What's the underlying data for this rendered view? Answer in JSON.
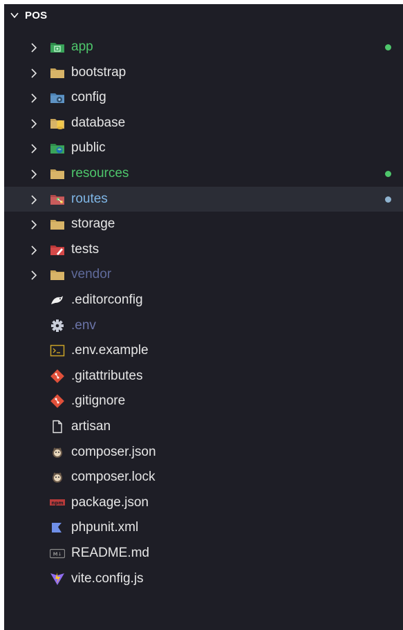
{
  "explorer": {
    "root_title": "POS",
    "items": [
      {
        "label": "app",
        "type": "folder",
        "icon": "app-folder-icon",
        "label_color": "#4ec66b",
        "status_dot": "#4ec66b"
      },
      {
        "label": "bootstrap",
        "type": "folder",
        "icon": "folder-icon"
      },
      {
        "label": "config",
        "type": "folder",
        "icon": "config-folder-icon"
      },
      {
        "label": "database",
        "type": "folder",
        "icon": "database-folder-icon"
      },
      {
        "label": "public",
        "type": "folder",
        "icon": "public-folder-icon"
      },
      {
        "label": "resources",
        "type": "folder",
        "icon": "folder-icon",
        "label_color": "#4ec66b",
        "status_dot": "#4ec66b"
      },
      {
        "label": "routes",
        "type": "folder",
        "icon": "routes-folder-icon",
        "label_color": "#7fb6e6",
        "status_dot": "#8fb3cf",
        "selected": true
      },
      {
        "label": "storage",
        "type": "folder",
        "icon": "folder-icon"
      },
      {
        "label": "tests",
        "type": "folder",
        "icon": "tests-folder-icon"
      },
      {
        "label": "vendor",
        "type": "folder",
        "icon": "folder-icon",
        "label_color": "#5f6a9a"
      },
      {
        "label": ".editorconfig",
        "type": "file",
        "icon": "editorconfig-icon"
      },
      {
        "label": ".env",
        "type": "file",
        "icon": "gear-icon",
        "label_color": "#6b74a8"
      },
      {
        "label": ".env.example",
        "type": "file",
        "icon": "terminal-icon"
      },
      {
        "label": ".gitattributes",
        "type": "file",
        "icon": "git-icon"
      },
      {
        "label": ".gitignore",
        "type": "file",
        "icon": "git-icon"
      },
      {
        "label": "artisan",
        "type": "file",
        "icon": "file-icon"
      },
      {
        "label": "composer.json",
        "type": "file",
        "icon": "composer-icon"
      },
      {
        "label": "composer.lock",
        "type": "file",
        "icon": "composer-icon"
      },
      {
        "label": "package.json",
        "type": "file",
        "icon": "npm-icon",
        "icon_text": "npm"
      },
      {
        "label": "phpunit.xml",
        "type": "file",
        "icon": "phpunit-icon"
      },
      {
        "label": "README.md",
        "type": "file",
        "icon": "markdown-icon",
        "icon_text": "M↓"
      },
      {
        "label": "vite.config.js",
        "type": "file",
        "icon": "vite-icon"
      }
    ]
  },
  "colors": {
    "background": "#1e1e26",
    "selected_row": "#2b2d36",
    "git_added": "#4ec66b",
    "git_modified": "#8fb3cf"
  }
}
